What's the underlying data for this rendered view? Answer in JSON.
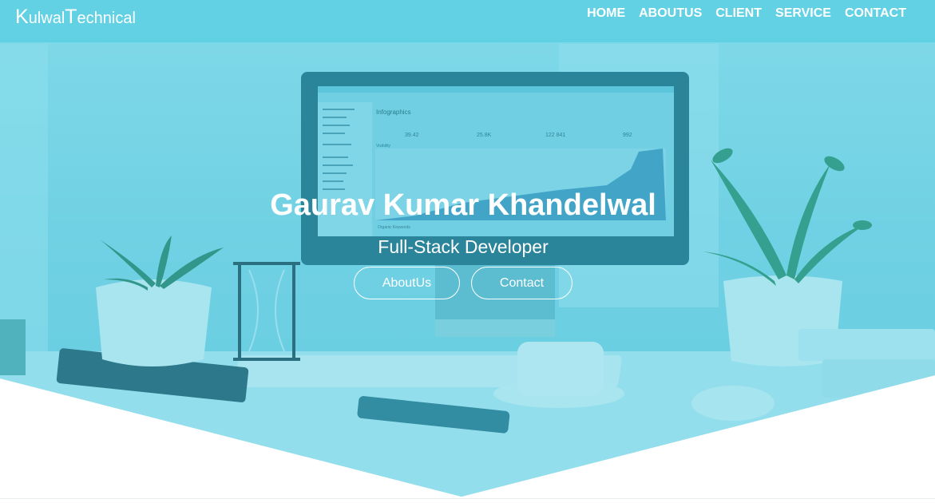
{
  "brand": {
    "first_initial": "K",
    "first_rest": "ulwal",
    "second_initial": "T",
    "second_rest": "echnical"
  },
  "nav": {
    "items": [
      {
        "label": "HOME"
      },
      {
        "label": "ABOUTUS"
      },
      {
        "label": "CLIENT"
      },
      {
        "label": "SERVICE"
      },
      {
        "label": "CONTACT"
      }
    ]
  },
  "hero": {
    "title": "Gaurav Kumar Khandelwal",
    "subtitle": "Full-Stack Developer",
    "buttons": {
      "about": "AboutUs",
      "contact": "Contact"
    }
  },
  "monitor_screen": {
    "heading": "Infographics",
    "stats": [
      "39.42",
      "25.8K",
      "122 841",
      "992"
    ],
    "section_visibility": "Visibility",
    "section_keywords": "Organic Keywords"
  },
  "colors": {
    "overlay": "#40c4dc",
    "navbar": "#58cee2",
    "text": "#ffffff"
  }
}
